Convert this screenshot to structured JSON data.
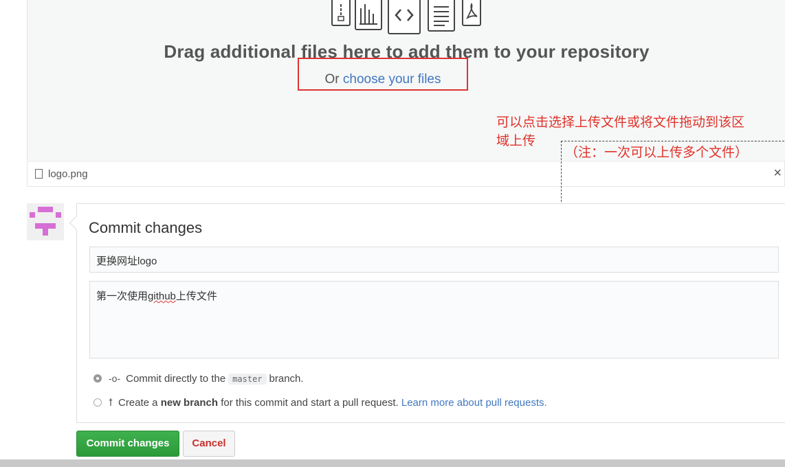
{
  "dropzone": {
    "icons": [
      "zip-file-icon",
      "chart-file-icon",
      "code-file-icon",
      "text-file-icon",
      "pdf-file-icon"
    ],
    "title": "Drag additional files here to add them to your repository",
    "choose_prefix": "Or ",
    "choose_link": "choose your files"
  },
  "annotation": {
    "line1": "可以点击选择上传文件或将文件拖动到该区",
    "line2": "域上传",
    "note": "（注：一次可以上传多个文件）"
  },
  "file_row": {
    "name": "logo.png",
    "close": "×"
  },
  "commit": {
    "title": "Commit changes",
    "summary_value": "更换网址logo",
    "desc_before": "第一次使用",
    "desc_squiggly": "github",
    "desc_after": "上传文件",
    "option1_pre": "Commit directly to the",
    "option1_branch": "master",
    "option1_post": "branch.",
    "option2_pre": "Create a",
    "option2_bold": "new branch",
    "option2_post": "for this commit and start a pull request.",
    "option2_link": "Learn more about pull requests.",
    "commit_button": "Commit changes",
    "cancel_button": "Cancel"
  },
  "colors": {
    "annotation_red": "#e0322a",
    "link_blue": "#4078c0",
    "commit_green": "#2b9a39"
  }
}
